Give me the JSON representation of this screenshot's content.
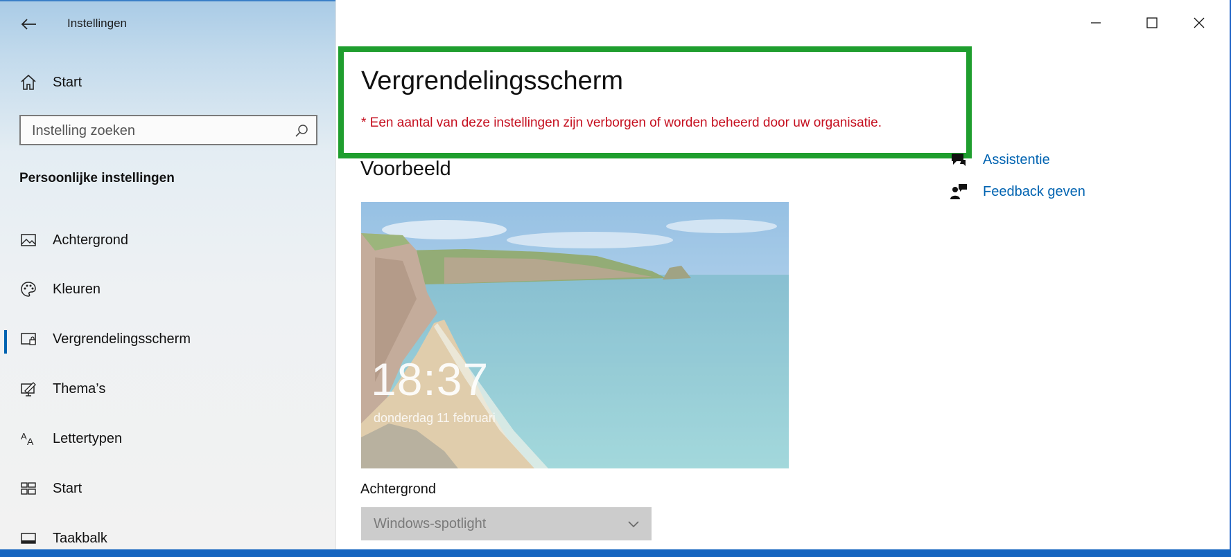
{
  "app": {
    "title": "Instellingen"
  },
  "sidebar": {
    "home_label": "Start",
    "search": {
      "placeholder": "Instelling zoeken"
    },
    "section_title": "Persoonlijke instellingen",
    "items": [
      {
        "label": "Achtergrond",
        "icon": "picture-icon"
      },
      {
        "label": "Kleuren",
        "icon": "palette-icon"
      },
      {
        "label": "Vergrendelingsscherm",
        "icon": "lock-screen-icon",
        "active": true
      },
      {
        "label": "Thema’s",
        "icon": "theme-brush-icon"
      },
      {
        "label": "Lettertypen",
        "icon": "font-icon"
      },
      {
        "label": "Start",
        "icon": "start-tiles-icon"
      },
      {
        "label": "Taakbalk",
        "icon": "taskbar-icon"
      }
    ]
  },
  "main": {
    "title": "Vergrendelingsscherm",
    "warning": "* Een aantal van deze instellingen zijn verborgen of worden beheerd door uw organisatie.",
    "preview_heading": "Voorbeeld",
    "preview": {
      "time": "18:37",
      "date": "donderdag 11 februari"
    },
    "background_label": "Achtergrond",
    "background_select": {
      "value": "Windows-spotlight"
    }
  },
  "related": {
    "links": [
      {
        "label": "Assistentie",
        "icon": "help-chat-icon"
      },
      {
        "label": "Feedback geven",
        "icon": "feedback-person-icon"
      }
    ]
  },
  "colors": {
    "accent": "#0063b1",
    "warning": "#c50f1f",
    "highlight_border": "#1f9e2e"
  }
}
